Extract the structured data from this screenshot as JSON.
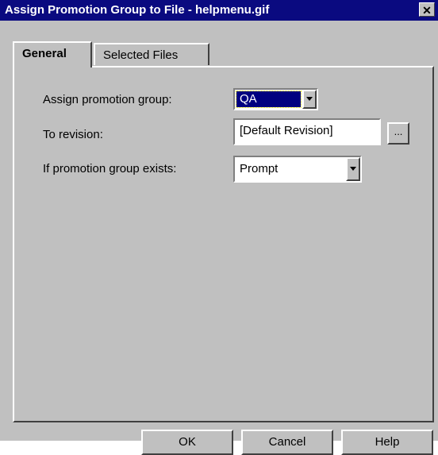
{
  "window": {
    "title": "Assign Promotion Group to File - helpmenu.gif",
    "close_label": "✕"
  },
  "tabs": [
    {
      "label": "General",
      "active": true
    },
    {
      "label": "Selected Files",
      "active": false
    }
  ],
  "form": {
    "promotion_group": {
      "label": "Assign promotion group:",
      "value": "QA"
    },
    "revision": {
      "label": "To revision:",
      "value": "[Default Revision]",
      "browse_label": "..."
    },
    "exists": {
      "label": "If promotion group exists:",
      "value": "Prompt"
    }
  },
  "buttons": {
    "ok": "OK",
    "cancel": "Cancel",
    "help": "Help"
  },
  "colors": {
    "titlebar": "#0a0a80",
    "face": "#c0c0c0",
    "selection": "#000080"
  }
}
